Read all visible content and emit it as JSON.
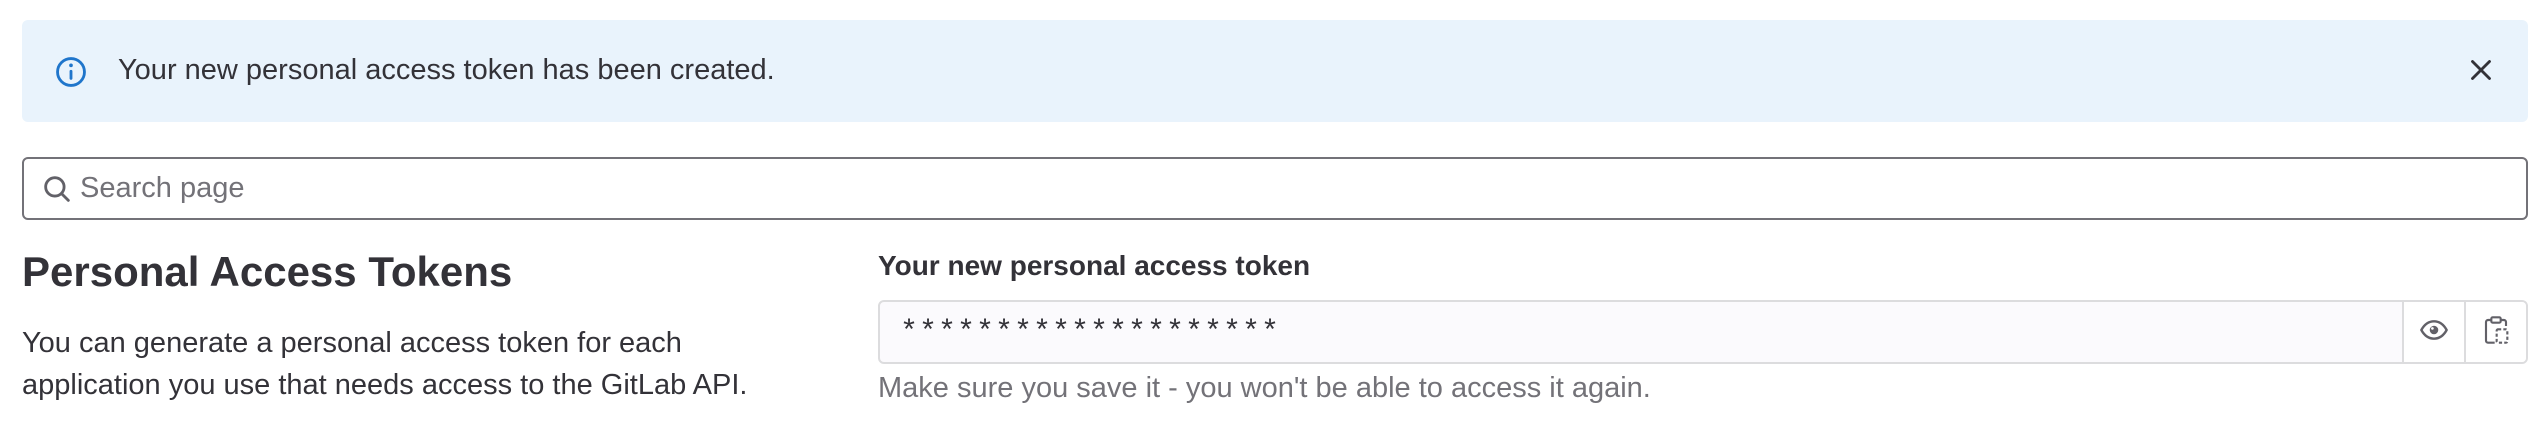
{
  "alert": {
    "message": "Your new personal access token has been created.",
    "icon": "info-icon",
    "close_icon": "close-icon",
    "background": "#e9f3fc"
  },
  "search": {
    "placeholder": "Search page",
    "value": "",
    "icon": "search-icon"
  },
  "section": {
    "title": "Personal Access Tokens",
    "description": "You can generate a personal access token for each application you use that needs access to the GitLab API."
  },
  "token": {
    "label": "Your new personal access token",
    "masked_value": "********************",
    "help_text": "Make sure you save it - you won't be able to access it again.",
    "reveal_icon": "eye-icon",
    "copy_icon": "clipboard-icon"
  },
  "colors": {
    "info_blue": "#1f75cb",
    "text": "#333238",
    "muted": "#737278",
    "border": "#dcdcde"
  }
}
